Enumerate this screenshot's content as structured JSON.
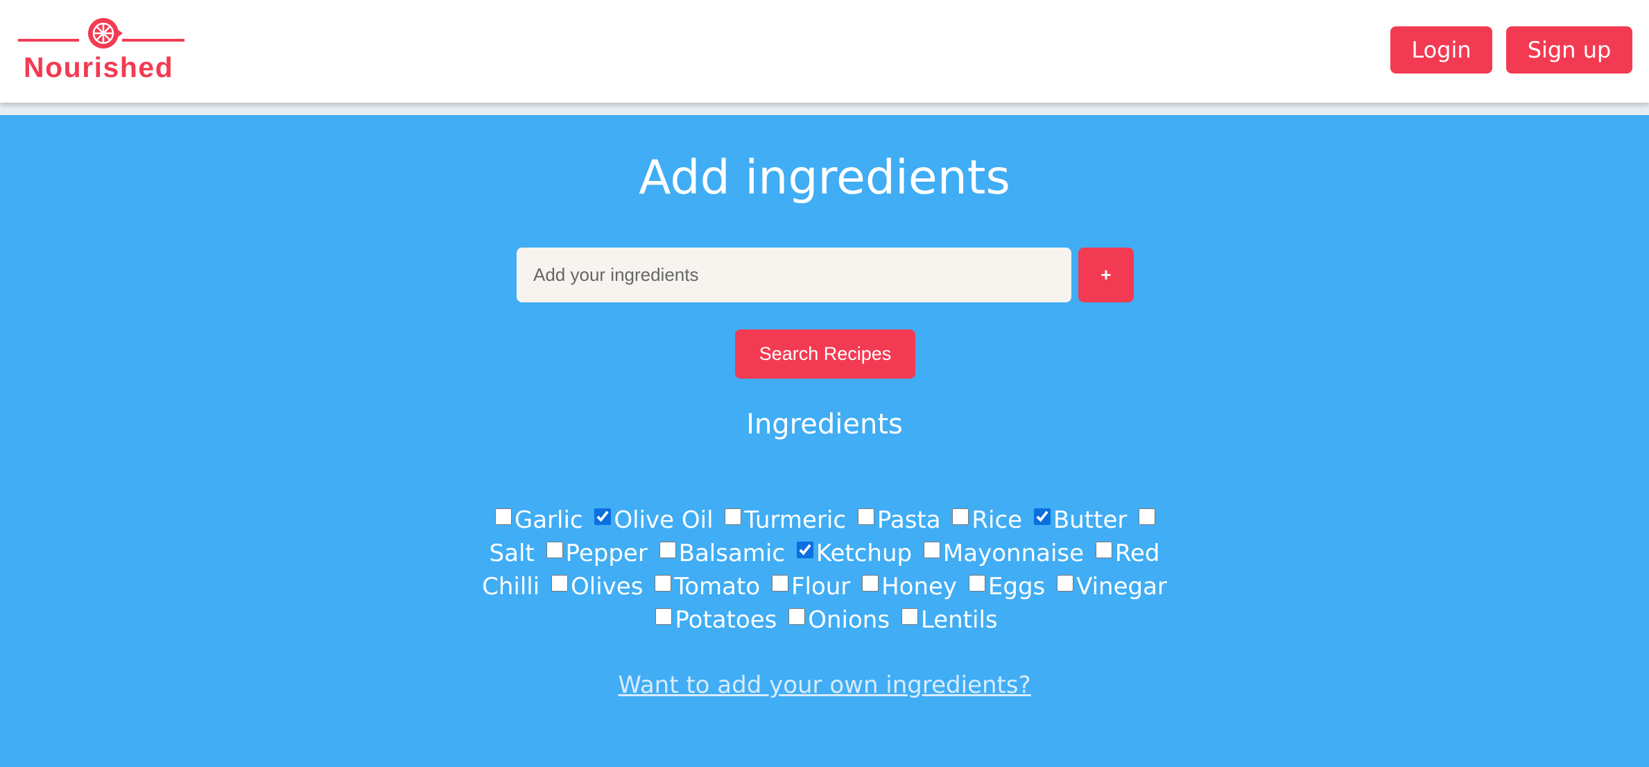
{
  "brand": {
    "name": "Nourished",
    "color": "#f23b52"
  },
  "header": {
    "login_label": "Login",
    "signup_label": "Sign up"
  },
  "main": {
    "title": "Add ingredients",
    "input_placeholder": "Add your ingredients",
    "add_button_label": "+",
    "search_button_label": "Search Recipes",
    "ingredients_heading": "Ingredients",
    "own_ingredients_link": "Want to add your own ingredients?",
    "background_color": "#40adf5"
  },
  "ingredients": [
    {
      "label": "Garlic",
      "checked": false
    },
    {
      "label": "Olive Oil",
      "checked": true
    },
    {
      "label": "Turmeric",
      "checked": false
    },
    {
      "label": "Pasta",
      "checked": false
    },
    {
      "label": "Rice",
      "checked": false
    },
    {
      "label": "Butter",
      "checked": true
    },
    {
      "label": "Salt",
      "checked": false
    },
    {
      "label": "Pepper",
      "checked": false
    },
    {
      "label": "Balsamic",
      "checked": false
    },
    {
      "label": "Ketchup",
      "checked": true
    },
    {
      "label": "Mayonnaise",
      "checked": false
    },
    {
      "label": "Red Chilli",
      "checked": false
    },
    {
      "label": "Olives",
      "checked": false
    },
    {
      "label": "Tomato",
      "checked": false
    },
    {
      "label": "Flour",
      "checked": false
    },
    {
      "label": "Honey",
      "checked": false
    },
    {
      "label": "Eggs",
      "checked": false
    },
    {
      "label": "Vinegar",
      "checked": false
    },
    {
      "label": "Potatoes",
      "checked": false
    },
    {
      "label": "Onions",
      "checked": false
    },
    {
      "label": "Lentils",
      "checked": false
    }
  ]
}
